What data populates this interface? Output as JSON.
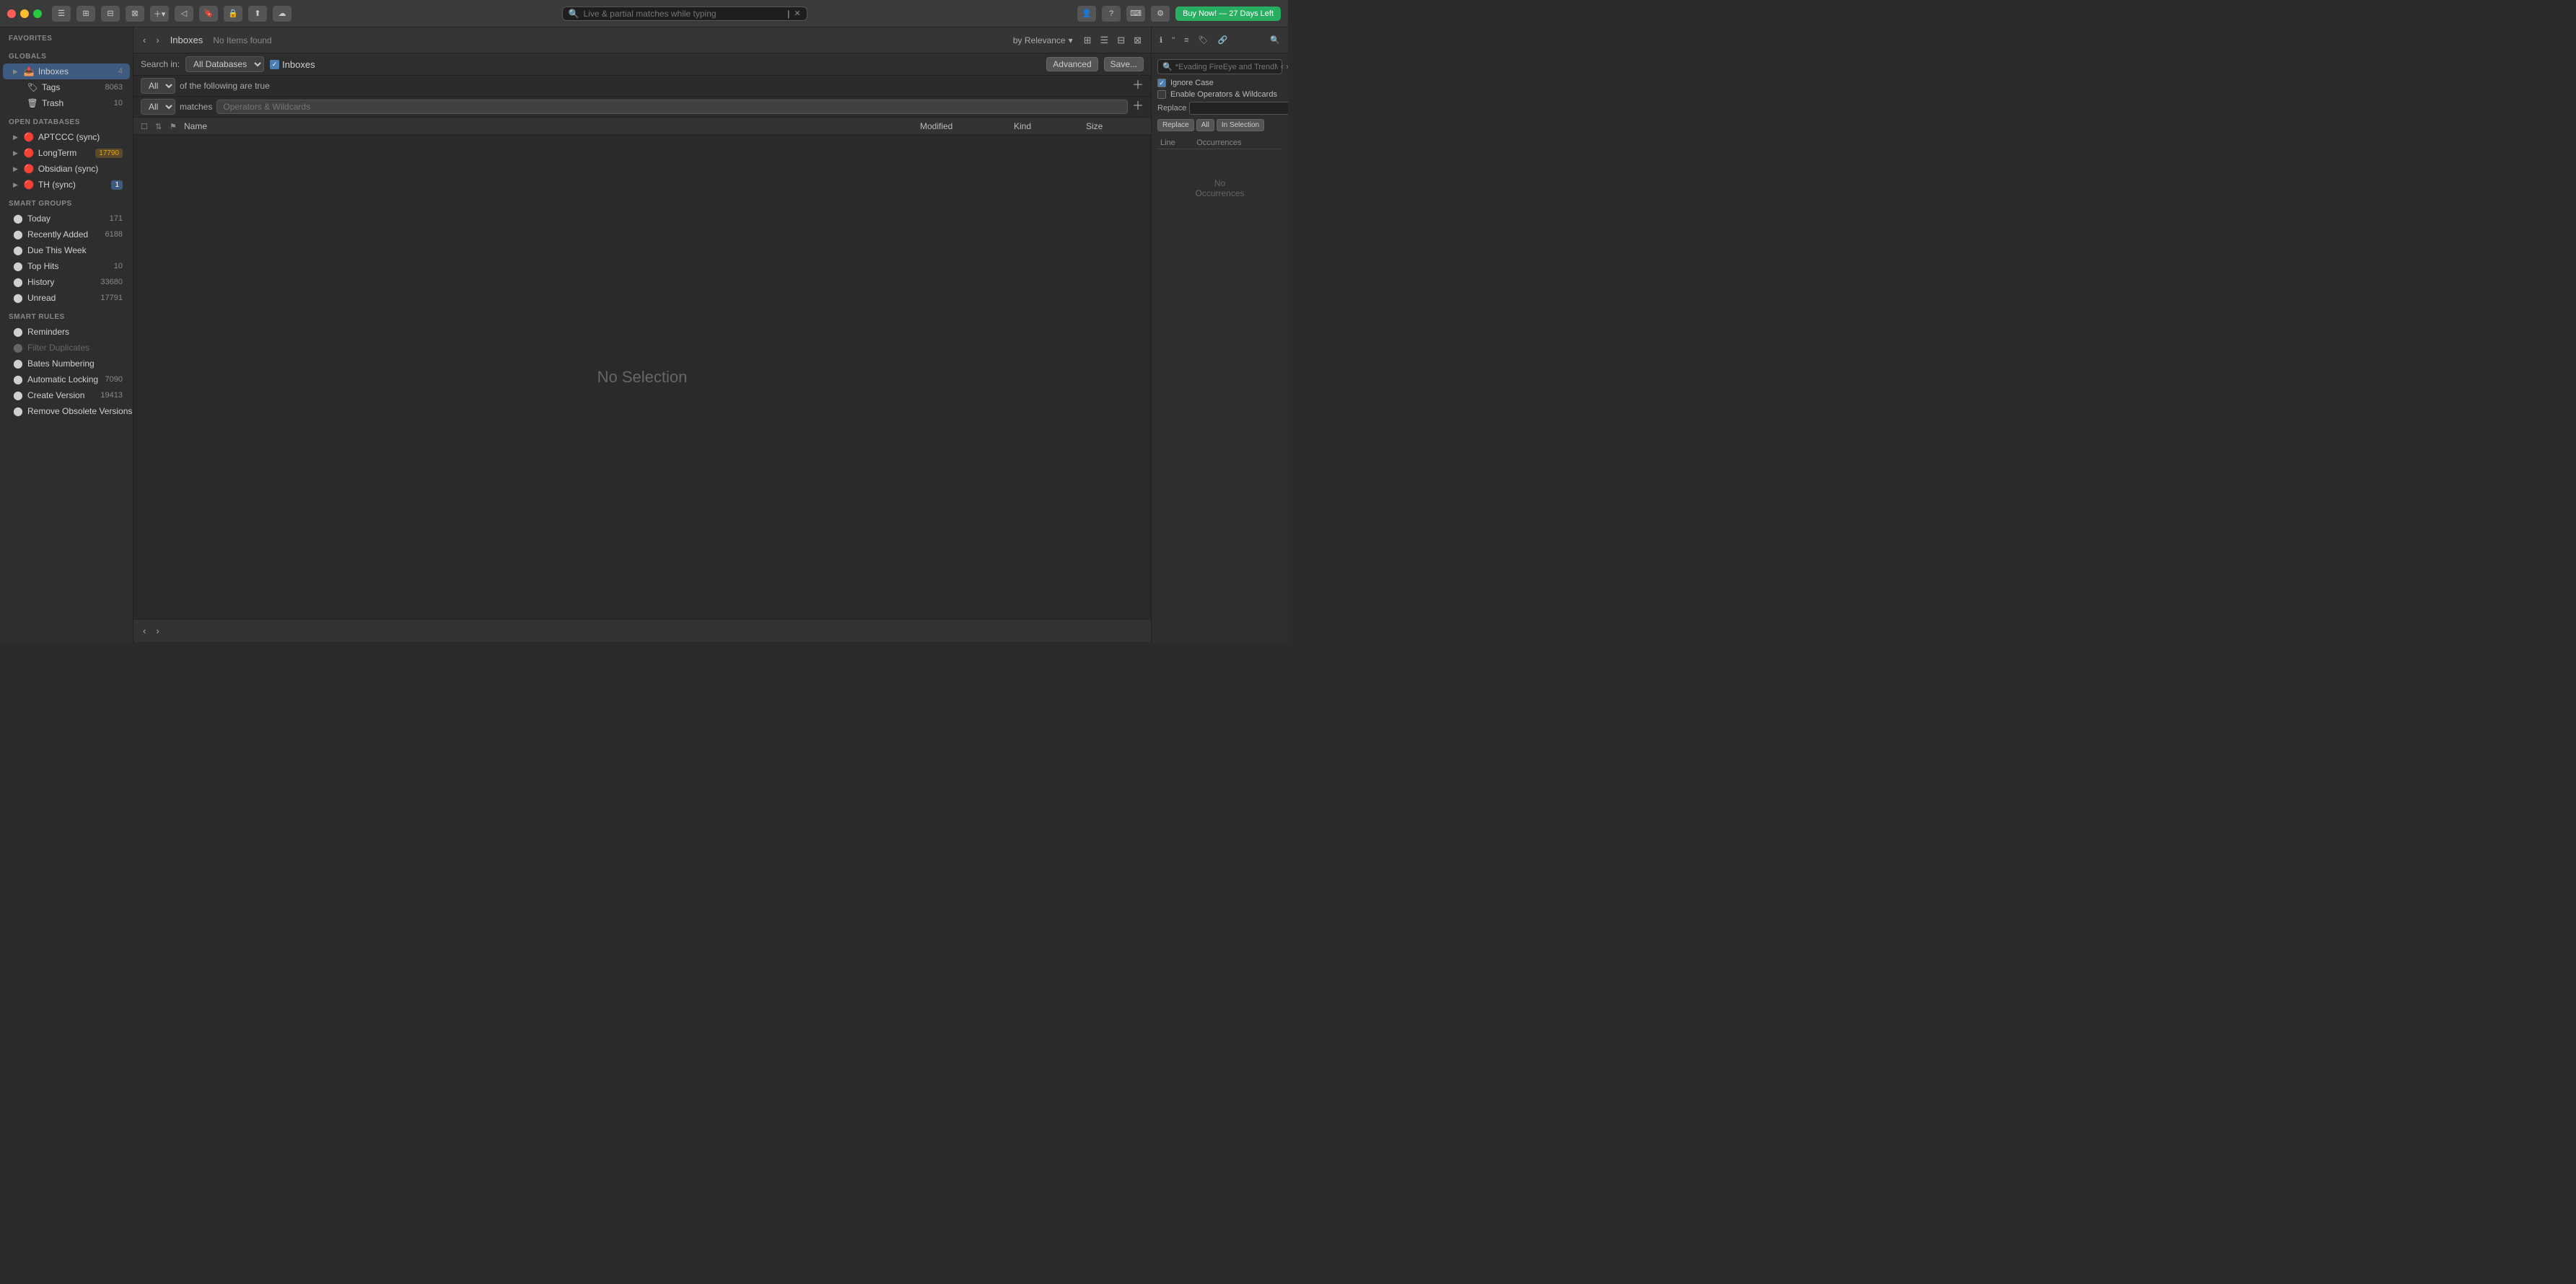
{
  "titlebar": {
    "buy_label": "Buy Now! — 27 Days Left",
    "search_placeholder": "Live & partial matches while typing"
  },
  "toolbar": {
    "back_label": "‹",
    "forward_label": "›",
    "title": "Inboxes",
    "status": "No Items found",
    "sort_label": "by Relevance",
    "sort_arrow": "▾"
  },
  "search_options": {
    "search_in_label": "Search in:",
    "all_databases_label": "All Databases",
    "inboxes_label": "Inboxes",
    "all_label": "All",
    "of_following_label": "of the following are true",
    "matches_label": "matches",
    "operators_label": "Operators & Wildcards",
    "advanced_label": "Advanced",
    "save_label": "Save..."
  },
  "table_headers": {
    "name": "Name",
    "modified": "Modified",
    "kind": "Kind",
    "size": "Size"
  },
  "main_content": {
    "no_selection": "No Selection"
  },
  "sidebar": {
    "favorites_label": "Favorites",
    "globals_label": "Globals",
    "globals_items": [
      {
        "label": "Inboxes",
        "badge": "4",
        "active": true
      },
      {
        "label": "Tags",
        "badge": "8063"
      },
      {
        "label": "Trash",
        "badge": "10"
      }
    ],
    "open_databases_label": "Open Databases",
    "databases": [
      {
        "label": "APTCCC (sync)",
        "badge": ""
      },
      {
        "label": "LongTerm",
        "badge": "17790"
      },
      {
        "label": "Obsidian (sync)",
        "badge": ""
      },
      {
        "label": "TH (sync)",
        "badge": "1"
      }
    ],
    "smart_groups_label": "Smart Groups",
    "smart_groups": [
      {
        "label": "Today",
        "badge": "171"
      },
      {
        "label": "Recently Added",
        "badge": "6188"
      },
      {
        "label": "Due This Week",
        "badge": ""
      },
      {
        "label": "Top Hits",
        "badge": "10"
      },
      {
        "label": "History",
        "badge": "33680"
      },
      {
        "label": "Unread",
        "badge": "17791"
      }
    ],
    "smart_rules_label": "Smart Rules",
    "smart_rules": [
      {
        "label": "Reminders",
        "badge": "",
        "muted": false
      },
      {
        "label": "Filter Duplicates",
        "badge": "",
        "muted": true
      },
      {
        "label": "Bates Numbering",
        "badge": "",
        "muted": false
      },
      {
        "label": "Automatic Locking",
        "badge": "7090",
        "muted": false
      },
      {
        "label": "Create Version",
        "badge": "19413",
        "muted": false
      },
      {
        "label": "Remove Obsolete Versions",
        "badge": "",
        "muted": false
      }
    ]
  },
  "right_panel": {
    "search_placeholder": "*Evading FireEye and TrendMicro*",
    "ignore_case_label": "Ignore Case",
    "enable_operators_label": "Enable Operators & Wildcards",
    "replace_label": "Replace",
    "replace_btn": "Replace",
    "all_btn": "All",
    "in_selection_btn": "In Selection",
    "col_line": "Line",
    "col_occurrences": "Occurrences",
    "no_occurrences": "No",
    "no_occurrences2": "Occurrences"
  }
}
